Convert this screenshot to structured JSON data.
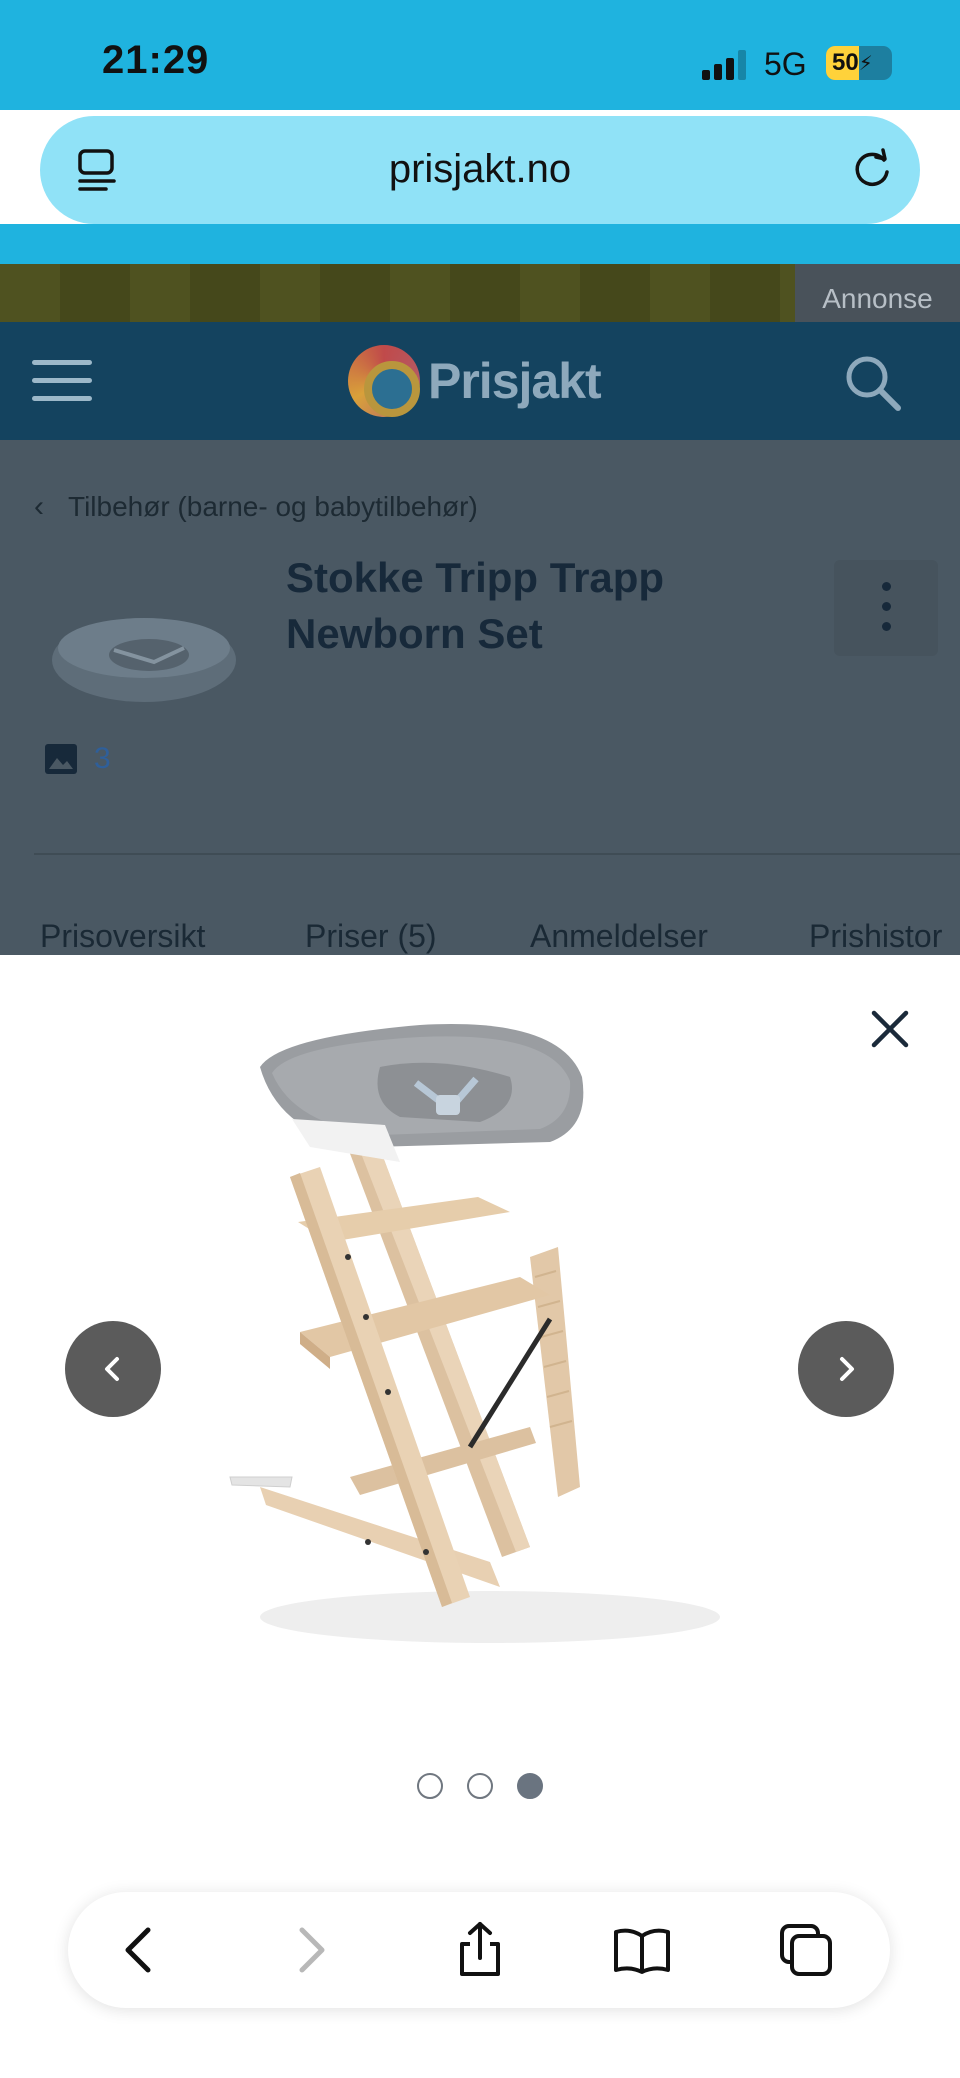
{
  "status_bar": {
    "time": "21:29",
    "network": "5G",
    "battery": "50",
    "battery_level": 0.5
  },
  "browser": {
    "url": "prisjakt.no",
    "reader_icon": "reader-mode-icon",
    "reload_icon": "reload-icon"
  },
  "ad": {
    "label": "Annonse"
  },
  "site": {
    "logo_text": "Prisjakt",
    "menu_icon": "hamburger-menu-icon",
    "search_icon": "search-icon"
  },
  "product": {
    "breadcrumb": "Tilbehør (barne- og babytilbehør)",
    "title": "Stokke Tripp Trapp Newborn Set",
    "image_count": "3",
    "tabs": [
      "Prisoversikt",
      "Priser (5)",
      "Anmeldelser",
      "Prishistor"
    ]
  },
  "viewer": {
    "image_alt": "Stokke Tripp Trapp chair with Newborn Set",
    "total_images": 3,
    "current_image": 3
  },
  "toolbar": {
    "items": [
      "back-icon",
      "forward-icon",
      "share-icon",
      "bookmarks-icon",
      "tabs-icon"
    ]
  },
  "colors": {
    "safari_blue": "#1fb3df",
    "address_bar": "#90e2f7",
    "site_header": "#14435f",
    "page_dim": "#4a5863",
    "nav_button": "#5b5b5b"
  }
}
